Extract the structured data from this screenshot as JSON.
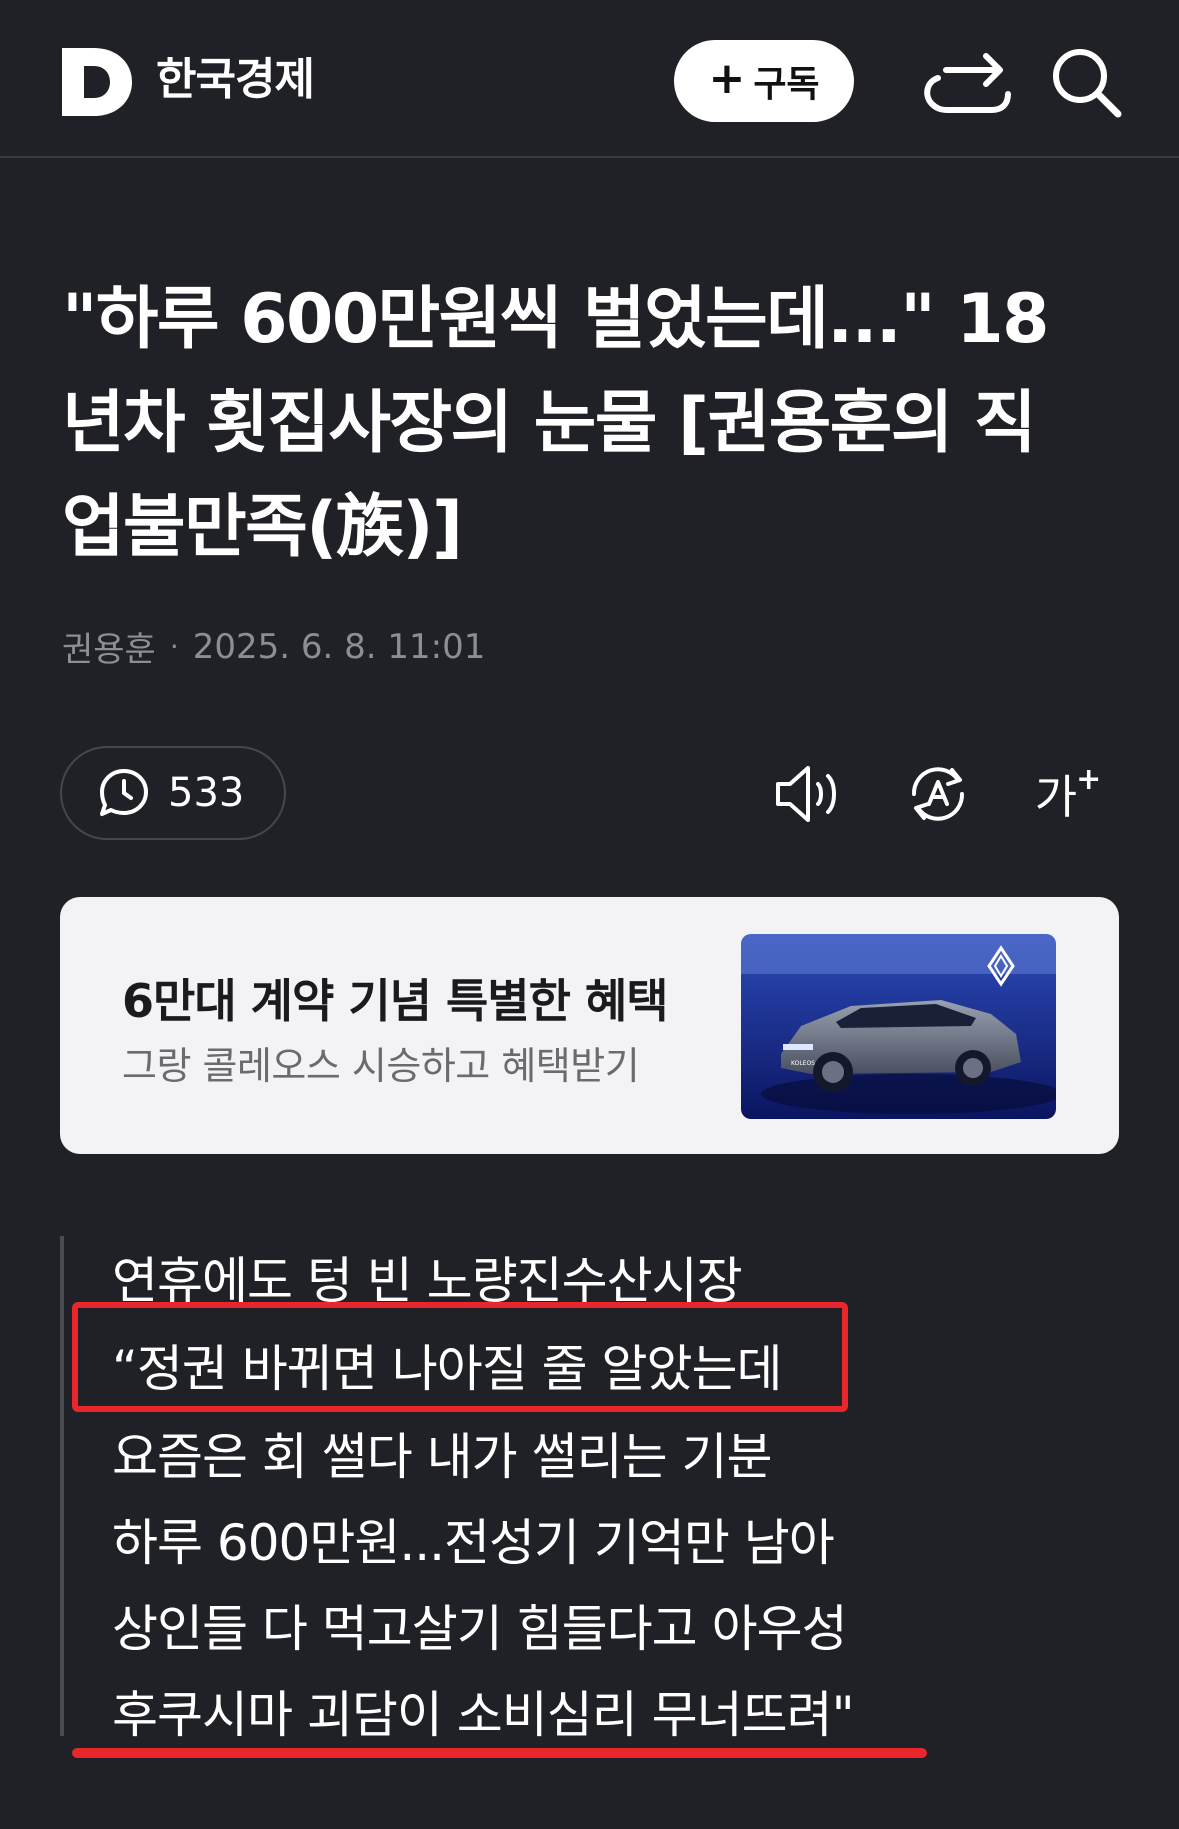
{
  "header": {
    "publisher": "한국경제",
    "subscribe_label": "구독",
    "icons": [
      "logo-d-icon",
      "plus-icon",
      "share-icon",
      "search-icon"
    ]
  },
  "article": {
    "title_lines": [
      "\"하루 600만원씩 벌었는데...\" 18",
      "년차 횟집사장의 눈물 [권용훈의 직",
      "업불만족(族)]"
    ],
    "author": "권용훈",
    "separator": "·",
    "datetime": "2025. 6. 8. 11:01",
    "comment_count": "533"
  },
  "tools": {
    "fontsize_label": "가"
  },
  "ad": {
    "title": "6만대 계약 기념 특별한 혜택",
    "subtitle": "그랑 콜레오스 시승하고 혜택받기",
    "car_plate": "KOLEOS"
  },
  "quote": {
    "lines": [
      "연휴에도 텅 빈 노량진수산시장",
      "“정권 바뀌면 나아질 줄 알았는데",
      "요즘은 회 썰다 내가 썰리는 기분",
      "하루 600만원...전성기 기억만 남아",
      "상인들 다 먹고살기 힘들다고 아우성",
      "후쿠시마 괴담이 소비심리 무너뜨려\""
    ]
  },
  "colors": {
    "background": "#202126",
    "accent_red": "#e8262b",
    "ad_background": "#f3f3f5"
  }
}
